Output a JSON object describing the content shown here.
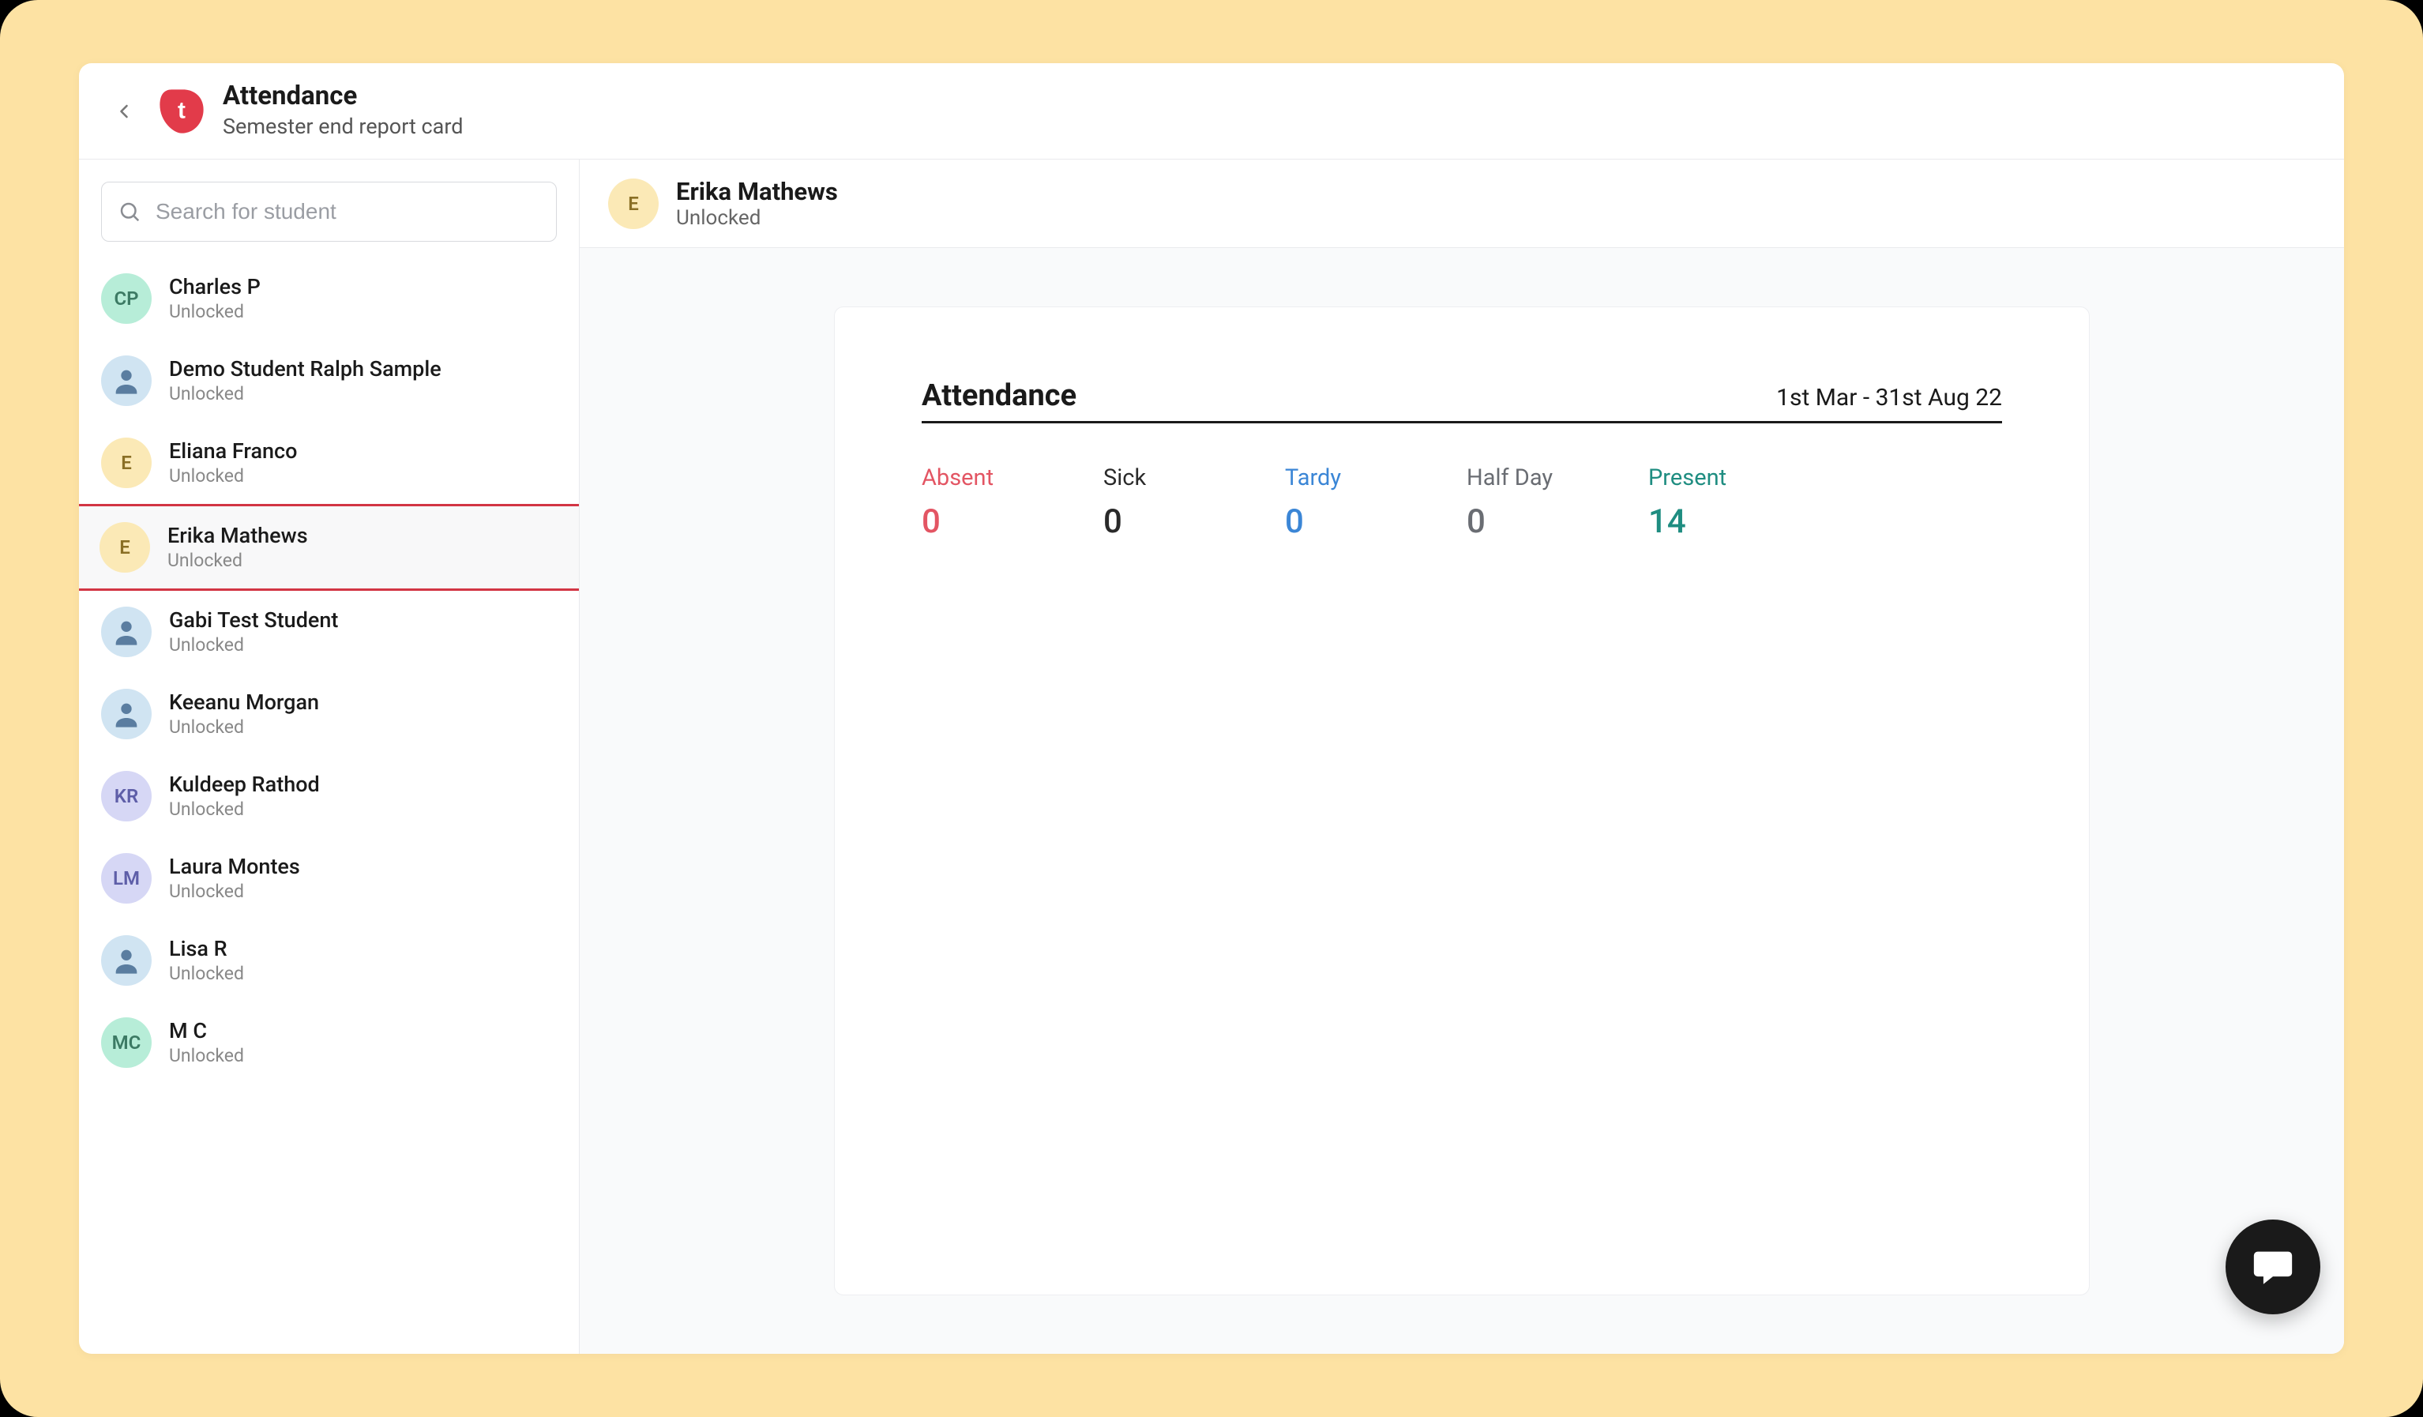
{
  "header": {
    "title": "Attendance",
    "subtitle": "Semester end report card"
  },
  "search": {
    "placeholder": "Search for student"
  },
  "students": [
    {
      "name": "Charles P",
      "status": "Unlocked",
      "avatar_type": "initials",
      "initials": "CP",
      "avatar_color": "green"
    },
    {
      "name": "Demo Student Ralph Sample",
      "status": "Unlocked",
      "avatar_type": "image",
      "initials": "",
      "avatar_color": "img"
    },
    {
      "name": "Eliana Franco",
      "status": "Unlocked",
      "avatar_type": "initials",
      "initials": "E",
      "avatar_color": "yellow"
    },
    {
      "name": "Erika Mathews",
      "status": "Unlocked",
      "avatar_type": "initials",
      "initials": "E",
      "avatar_color": "yellow",
      "selected": true
    },
    {
      "name": "Gabi Test Student",
      "status": "Unlocked",
      "avatar_type": "image",
      "initials": "",
      "avatar_color": "img"
    },
    {
      "name": "Keeanu Morgan",
      "status": "Unlocked",
      "avatar_type": "image",
      "initials": "",
      "avatar_color": "img"
    },
    {
      "name": "Kuldeep Rathod",
      "status": "Unlocked",
      "avatar_type": "initials",
      "initials": "KR",
      "avatar_color": "purple"
    },
    {
      "name": "Laura Montes",
      "status": "Unlocked",
      "avatar_type": "initials",
      "initials": "LM",
      "avatar_color": "purple"
    },
    {
      "name": "Lisa R",
      "status": "Unlocked",
      "avatar_type": "image",
      "initials": "",
      "avatar_color": "img"
    },
    {
      "name": "M C",
      "status": "Unlocked",
      "avatar_type": "initials",
      "initials": "MC",
      "avatar_color": "green"
    }
  ],
  "selected_student": {
    "name": "Erika Mathews",
    "status": "Unlocked",
    "initials": "E"
  },
  "attendance_card": {
    "title": "Attendance",
    "date_range": "1st Mar - 31st Aug 22",
    "stats": {
      "absent": {
        "label": "Absent",
        "value": "0"
      },
      "sick": {
        "label": "Sick",
        "value": "0"
      },
      "tardy": {
        "label": "Tardy",
        "value": "0"
      },
      "halfday": {
        "label": "Half Day",
        "value": "0"
      },
      "present": {
        "label": "Present",
        "value": "14"
      }
    }
  },
  "colors": {
    "accent_red": "#d23544",
    "frame_bg": "#fde2a3"
  }
}
